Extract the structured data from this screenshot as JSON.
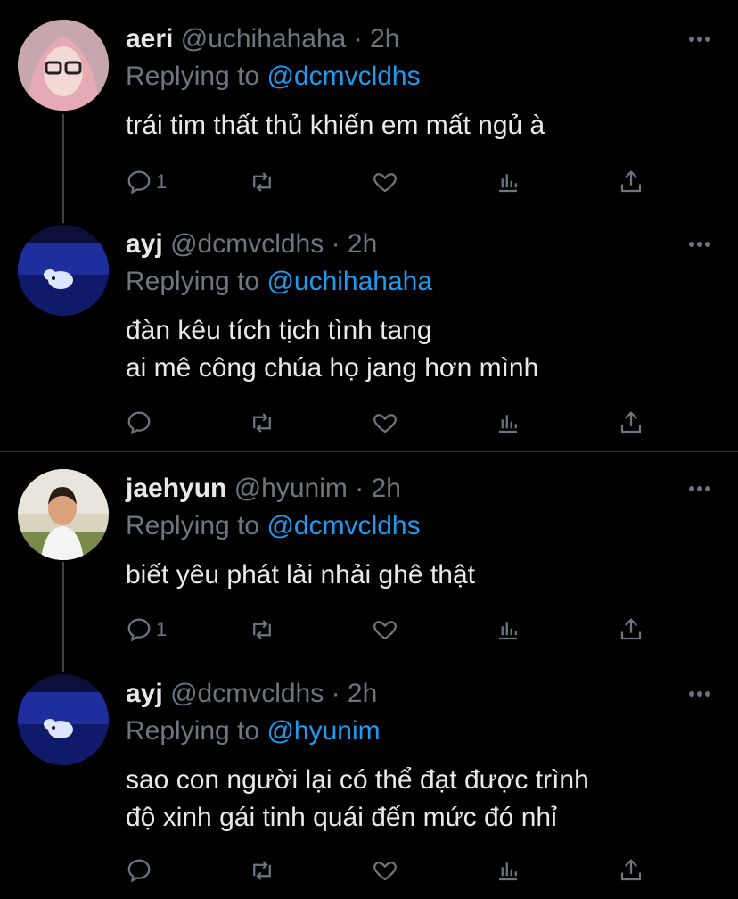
{
  "replies_label": "Replying to",
  "tweets": [
    {
      "name": "aeri",
      "handle": "@uchihahaha",
      "time": "· 2h",
      "replying_to": "@dcmvcldhs",
      "text": "trái tim thất thủ khiến em mất ngủ à",
      "reply_count": "1",
      "avatar_color": "#e8b4b8"
    },
    {
      "name": "ayj",
      "handle": "@dcmvcldhs",
      "time": "· 2h",
      "replying_to": "@uchihahaha",
      "text": "đàn kêu tích tịch tình tang\nai mê công chúa họ jang hơn mình",
      "reply_count": "",
      "avatar_color": "#1a2a8a"
    },
    {
      "name": "jaehyun",
      "handle": "@hyunim",
      "time": "· 2h",
      "replying_to": "@dcmvcldhs",
      "text": "biết yêu phát lải nhải ghê thật",
      "reply_count": "1",
      "avatar_color": "#c9c3a8"
    },
    {
      "name": "ayj",
      "handle": "@dcmvcldhs",
      "time": "· 2h",
      "replying_to": "@hyunim",
      "text": "sao con người lại có thể đạt được trình\nđộ xinh gái tinh quái đến mức đó nhỉ",
      "reply_count": "",
      "avatar_color": "#1a2a8a"
    }
  ],
  "icons": {
    "reply": "reply-icon",
    "retweet": "retweet-icon",
    "like": "heart-icon",
    "analytics": "analytics-icon",
    "share": "share-icon",
    "more": "more-icon"
  },
  "colors": {
    "background": "#000000",
    "accent": "#1d9bf0",
    "secondary_text": "#6e767d",
    "primary_text": "#e7e9ea"
  }
}
